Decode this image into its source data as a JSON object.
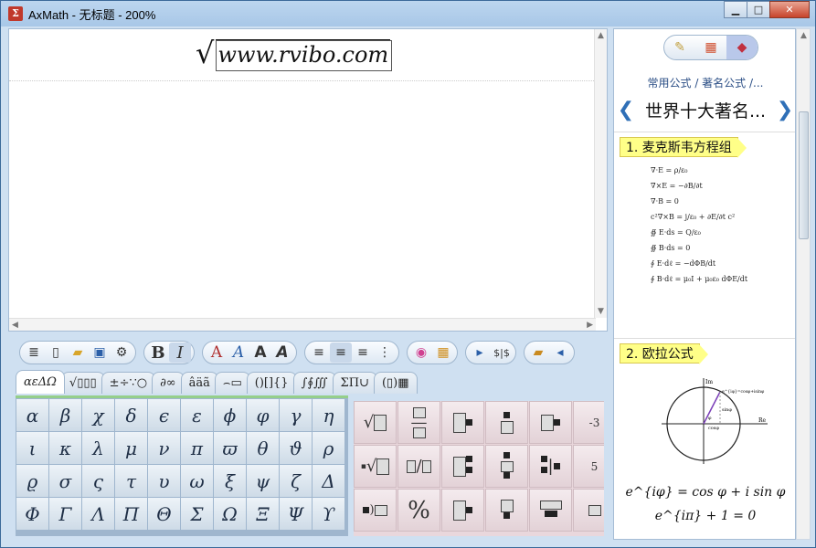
{
  "window": {
    "title": "AxMath - 无标题 - 200%",
    "app_icon_glyph": "Σ",
    "minimize": "▁",
    "maximize": "□",
    "close": "✕"
  },
  "editor": {
    "formula_text": "www.rvibo.com",
    "sqrt_glyph": "√"
  },
  "toolbar": {
    "bold": "B",
    "italic": "I",
    "font_buttons": [
      "A",
      "A",
      "A",
      "A"
    ]
  },
  "tabs": [
    "αεΔΩ",
    "√▯▯▯",
    "±÷∵○",
    "∂∞",
    "âäã",
    "⌢▭",
    "()[]{}",
    "∫∮∭",
    "ΣΠ∪",
    "(▯)▦"
  ],
  "greek": [
    [
      "α",
      "β",
      "χ",
      "δ",
      "ϵ",
      "ε",
      "ϕ",
      "φ",
      "γ",
      "η"
    ],
    [
      "ι",
      "κ",
      "λ",
      "μ",
      "ν",
      "π",
      "ϖ",
      "θ",
      "ϑ",
      "ρ"
    ],
    [
      "ϱ",
      "σ",
      "ς",
      "τ",
      "υ",
      "ω",
      "ξ",
      "ψ",
      "ζ",
      "Δ"
    ],
    [
      "Φ",
      "Γ",
      "Λ",
      "Π",
      "Θ",
      "Σ",
      "Ω",
      "Ξ",
      "Ψ",
      "ϒ"
    ]
  ],
  "templates_row3_label": "-3",
  "templates_row2_label": "5",
  "panel": {
    "breadcrumb": "常用公式 / 著名公式 /...",
    "title": "世界十大著名...",
    "nav_prev": "❮",
    "nav_next": "❯",
    "section1": "1. 麦克斯韦方程组",
    "section2": "2. 欧拉公式",
    "maxwell": [
      "∇·E = ρ/ε₀",
      "∇×E = −∂B/∂t",
      "∇·B = 0",
      "c²∇×B = j/ε₀ + ∂E/∂t c²",
      "∯ E·ds = Q/ε₀",
      "∯ B·ds = 0",
      "∮ E·dℓ = −dΦB/dt",
      "∮ B·dℓ = μ₀I + μ₀ε₀ dΦE/dt"
    ],
    "euler1": "e^{iφ} = cos φ + i sin φ",
    "euler2": "e^{iπ} + 1 = 0",
    "circle_labels": {
      "im": "Im",
      "re": "Re",
      "formula": "e^{iφ}=cosφ+isinφ",
      "sin": "sinφ",
      "cos": "cosφ",
      "phi": "φ"
    }
  }
}
